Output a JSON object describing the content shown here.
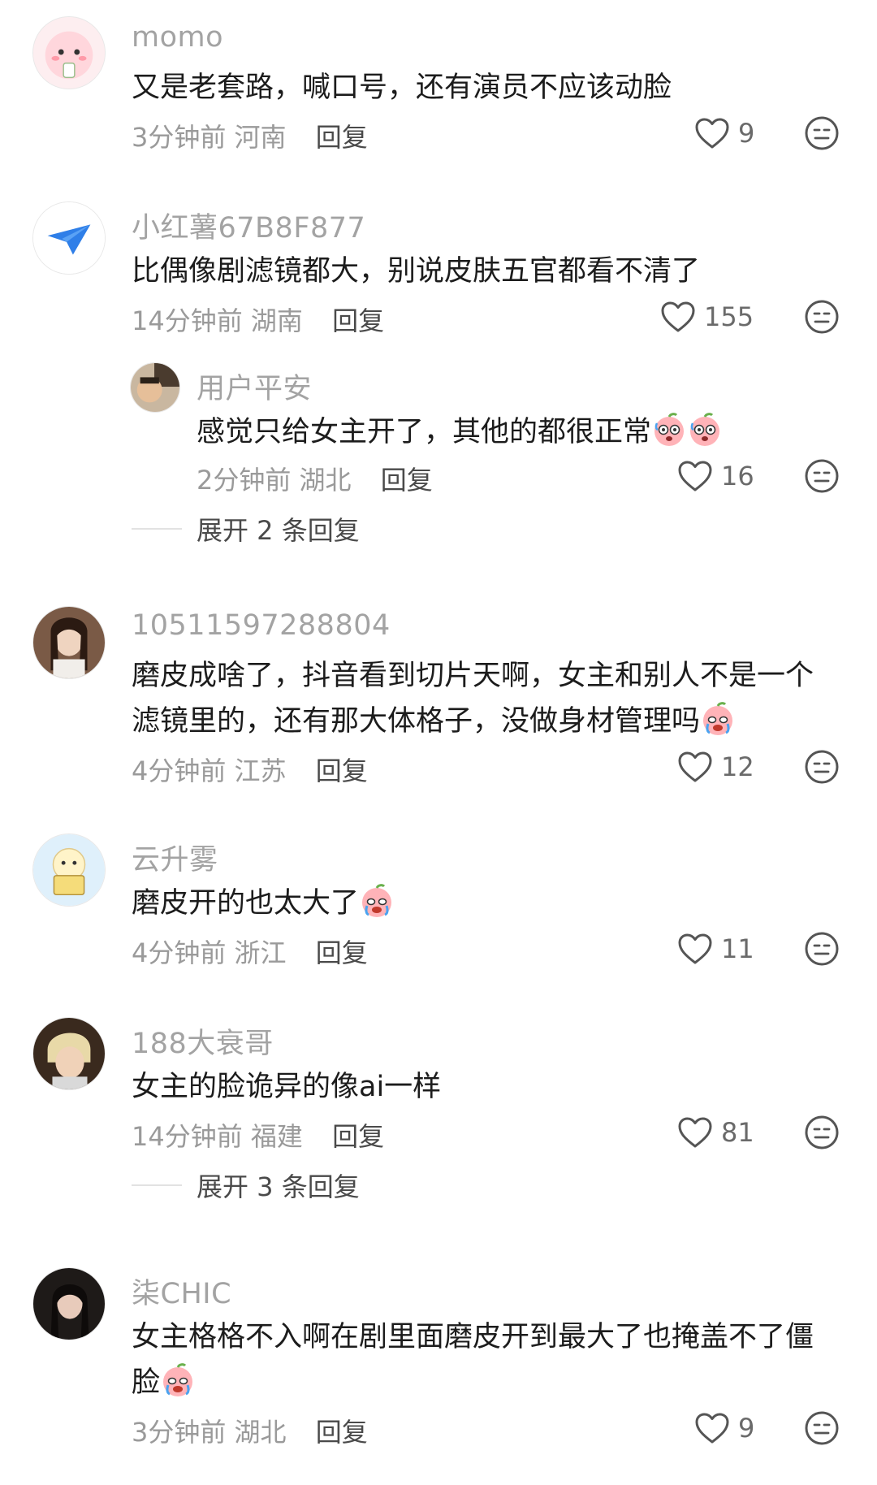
{
  "comments": [
    {
      "user": "momo",
      "text": [
        "又是老套路，喊口号，还有演员不应该动脸"
      ],
      "time": "3分钟前",
      "location": "河南",
      "reply_label": "回复",
      "likes": "9",
      "avatar_icon": "pink-mascot-avatar"
    },
    {
      "user": "小红薯67B8F877",
      "text": [
        "比偶像剧滤镜都大，别说皮肤五官都看不清了"
      ],
      "time": "14分钟前",
      "location": "湖南",
      "reply_label": "回复",
      "likes": "155",
      "avatar_icon": "paper-plane-avatar",
      "sub_reply": {
        "user": "用户平安",
        "text": "感觉只给女主开了，其他的都很正常",
        "time": "2分钟前",
        "location": "湖北",
        "reply_label": "回复",
        "likes": "16"
      },
      "expand_label": "展开 2 条回复"
    },
    {
      "user": "10511597288804",
      "text": [
        "磨皮成啥了，抖音看到切片天啊，女主和别人不是一个",
        "滤镜里的，还有那大体格子，没做身材管理吗"
      ],
      "time": "4分钟前",
      "location": "江苏",
      "reply_label": "回复",
      "likes": "12",
      "avatar_icon": "photo-avatar"
    },
    {
      "user": "云升雾",
      "text": [
        "磨皮开的也太大了"
      ],
      "time": "4分钟前",
      "location": "浙江",
      "reply_label": "回复",
      "likes": "11",
      "avatar_icon": "cartoon-avatar"
    },
    {
      "user": "188大衰哥",
      "text": [
        "女主的脸诡异的像ai一样"
      ],
      "time": "14分钟前",
      "location": "福建",
      "reply_label": "回复",
      "likes": "81",
      "avatar_icon": "photo-avatar",
      "expand_label": "展开 3 条回复"
    },
    {
      "user": "柒CHIC",
      "text": [
        "女主格格不入啊在剧里面磨皮开到最大了也掩盖不了僵",
        "脸"
      ],
      "time": "3分钟前",
      "location": "湖北",
      "reply_label": "回复",
      "likes": "9",
      "avatar_icon": "photo-avatar"
    }
  ],
  "icons": {
    "like": "heart-outline-icon",
    "dislike": "neutral-face-icon",
    "emoji_cry": "crying-peach-emoji",
    "emoji_shock": "shocked-peach-emoji"
  },
  "colors": {
    "username": "#a3a3a3",
    "text": "#1c1c1c",
    "meta": "#9a9a9a",
    "reply": "#4a4a4a"
  }
}
